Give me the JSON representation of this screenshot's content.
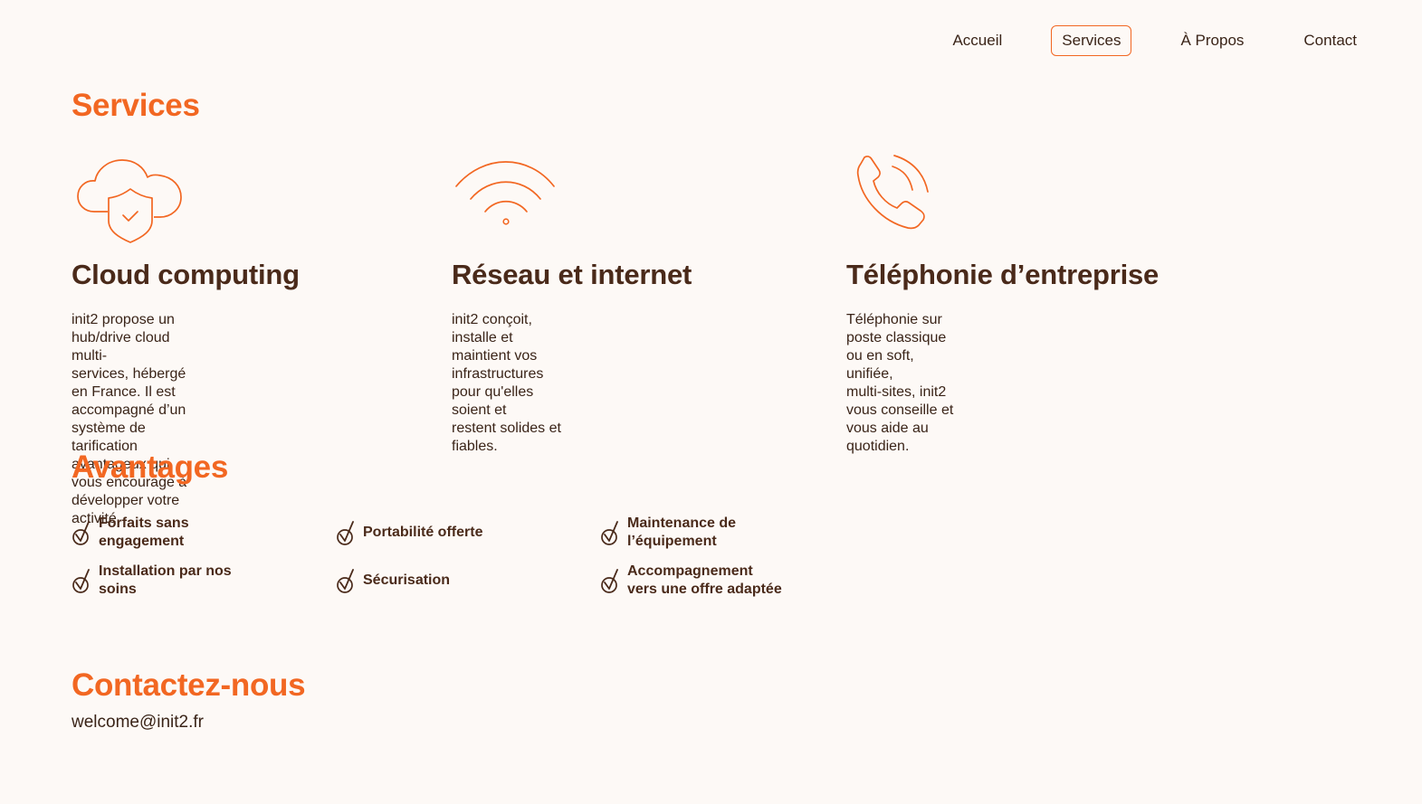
{
  "nav": {
    "items": [
      "Accueil",
      "Services",
      "À Propos",
      "Contact"
    ],
    "active_index": 1
  },
  "services": {
    "heading": "Services",
    "items": [
      {
        "icon": "cloud-shield-icon",
        "title": "Cloud computing",
        "lines": [
          "init2 propose un hub/drive cloud multi-",
          "services, hébergé en France. Il est",
          "accompagné d’un système de tarification",
          "avantageux qui vous encourage à",
          "développer votre activité."
        ]
      },
      {
        "icon": "wifi-icon",
        "title": "Réseau et internet",
        "lines": [
          "init2 conçoit, installe et maintient vos",
          "infrastructures pour qu'elles soient et",
          "restent solides et fiables."
        ]
      },
      {
        "icon": "phone-icon",
        "title": "Téléphonie d’entreprise",
        "lines": [
          "Téléphonie sur poste classique ou en soft, unifiée,",
          "multi-sites, init2 vous conseille et vous aide au",
          "quotidien."
        ]
      }
    ]
  },
  "advantages": {
    "heading": "Avantages",
    "items": [
      {
        "lines": [
          "Forfaits sans",
          "engagement"
        ]
      },
      {
        "lines": [
          "Portabilité offerte"
        ]
      },
      {
        "lines": [
          "Maintenance de",
          "l’équipement"
        ]
      },
      {
        "lines": [
          "Installation par nos",
          "soins"
        ]
      },
      {
        "lines": [
          "Sécurisation"
        ]
      },
      {
        "lines": [
          "Accompagnement",
          "vers une offre adaptée"
        ]
      }
    ]
  },
  "contact": {
    "heading": "Contactez-nous",
    "email": "welcome@init2.fr"
  },
  "colors": {
    "accent": "#f26722",
    "text_dark": "#4a2a1a",
    "background": "#fdf9f6"
  }
}
